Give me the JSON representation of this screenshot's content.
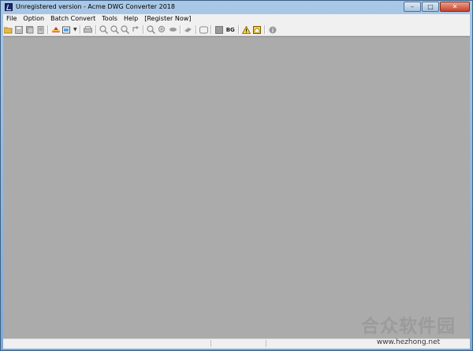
{
  "window": {
    "title": "Unregistered version - Acme DWG Converter 2018",
    "controls": {
      "minimize": "–",
      "maximize": "□",
      "close": "✕"
    }
  },
  "menu": {
    "items": [
      "File",
      "Option",
      "Batch Convert",
      "Tools",
      "Help",
      "[Register Now]"
    ]
  },
  "toolbar": {
    "bg_label": "BG",
    "icons": [
      "open-folder-icon",
      "save-icon",
      "save-as-icon",
      "print-preview-icon",
      "convert-icon",
      "layers-icon",
      "print-icon",
      "zoom-in-icon",
      "zoom-out-icon",
      "zoom-window-icon",
      "zoom-previous-icon",
      "zoom-extents-icon",
      "pan-icon",
      "rotate-icon",
      "layer-icon",
      "layout-icon",
      "background-icon",
      "warning-icon",
      "home-icon",
      "info-icon"
    ]
  },
  "watermark": {
    "text_cn": "合众软件园",
    "url": "www.hezhong.net"
  },
  "colors": {
    "canvas": "#ababab",
    "frame": "#a9c8e6",
    "menu_bg": "#f0f0f0"
  }
}
